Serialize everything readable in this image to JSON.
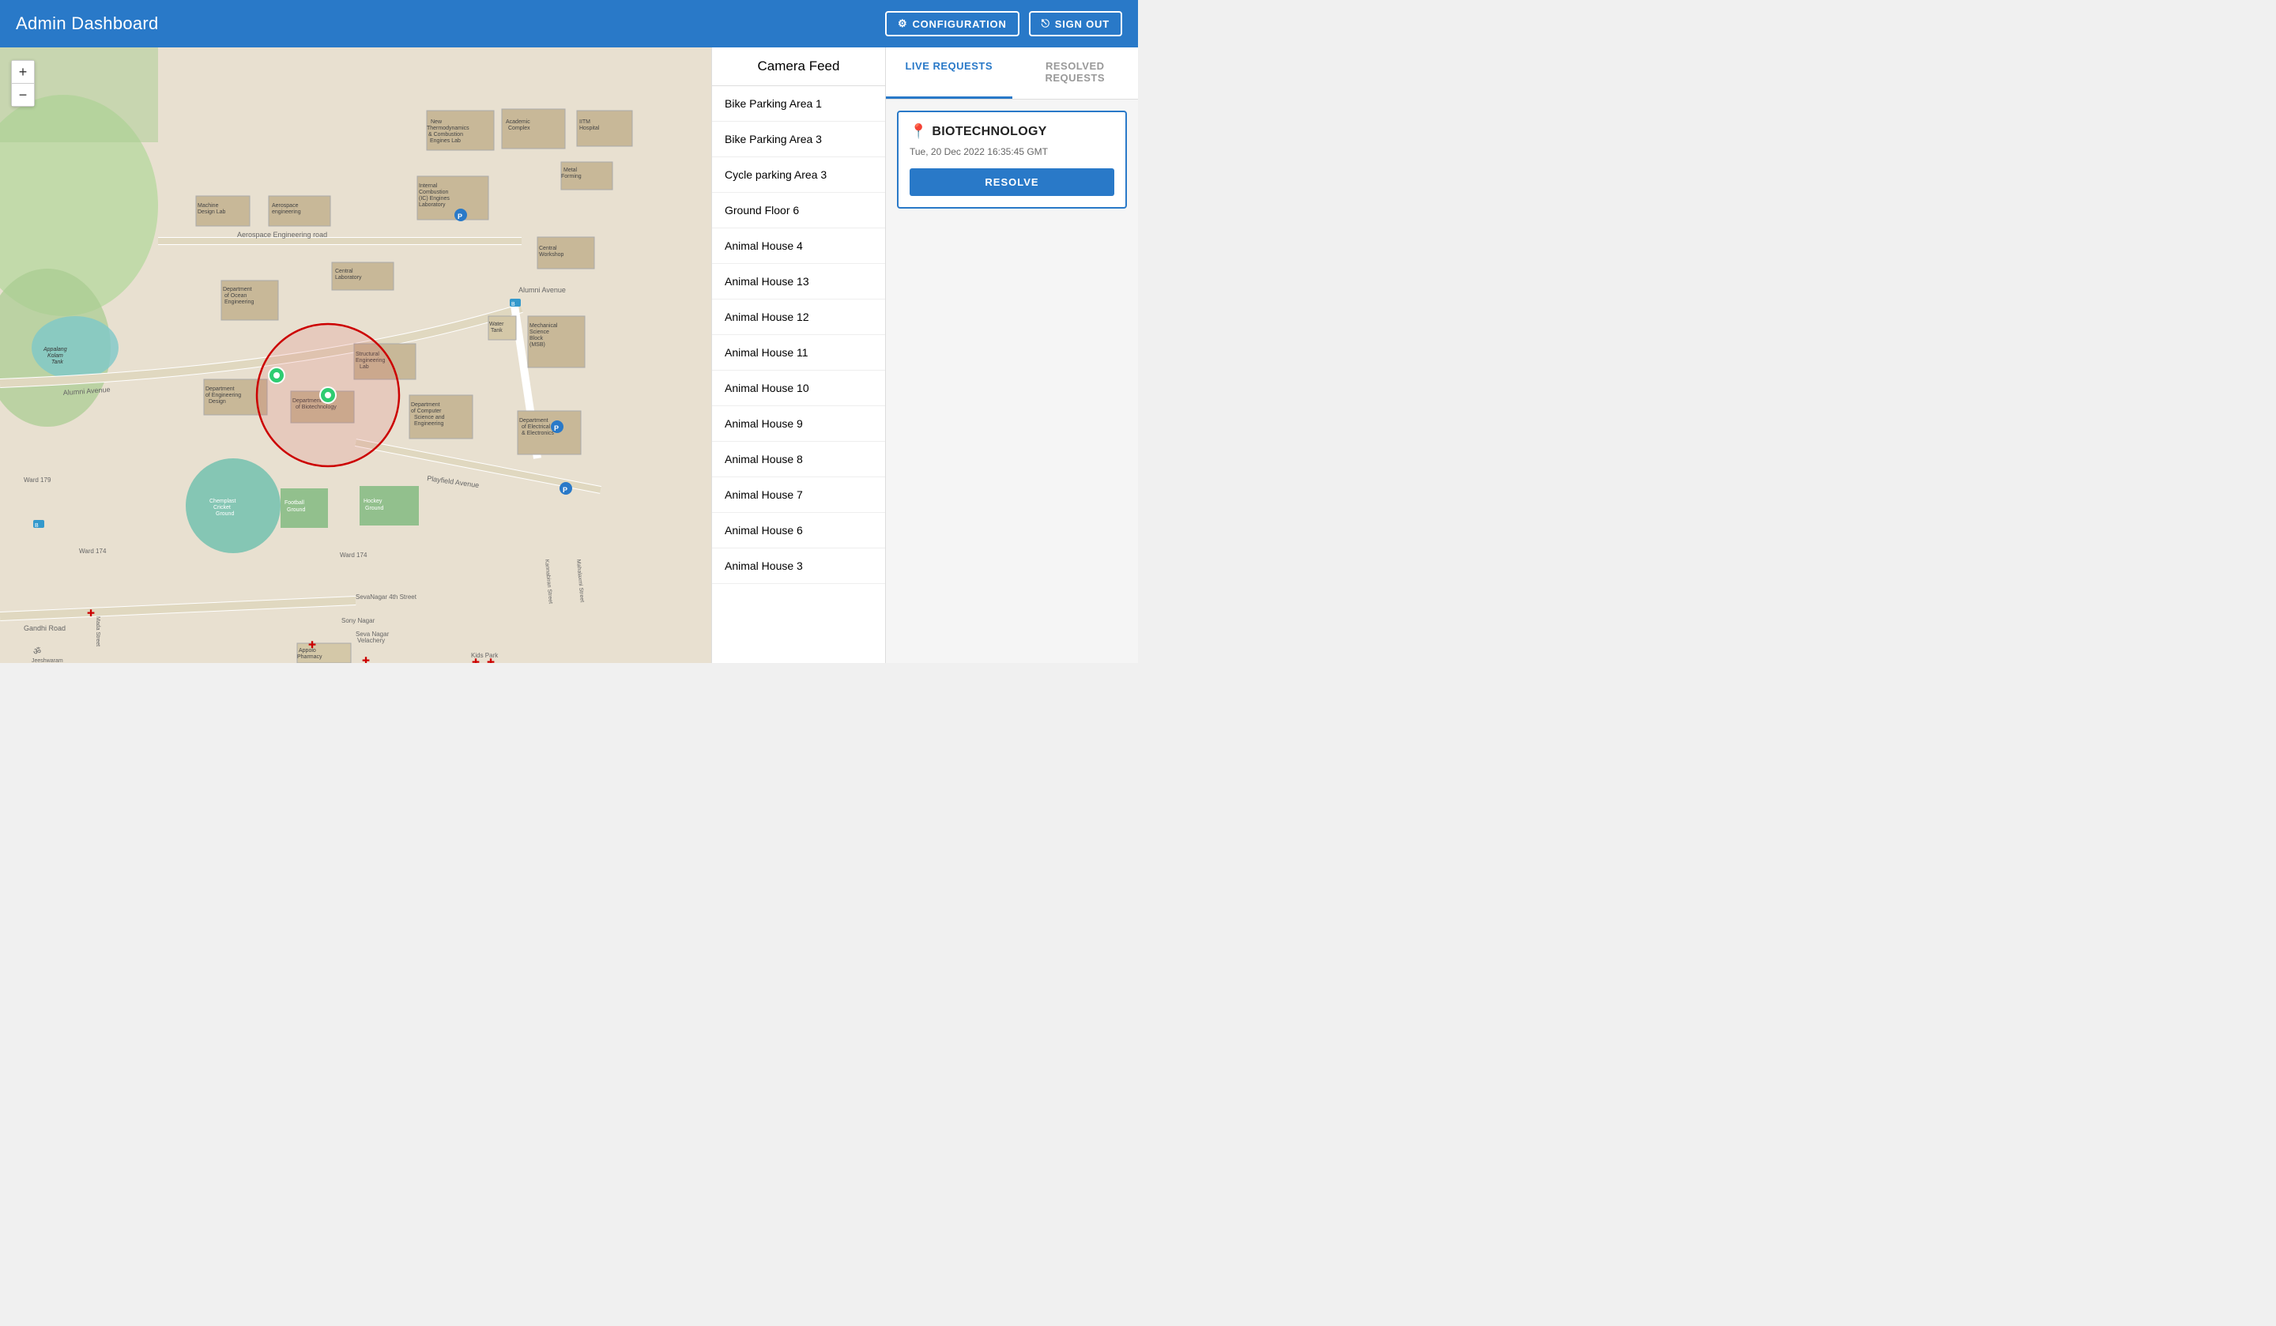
{
  "header": {
    "title": "Admin Dashboard",
    "config_label": "CONFIGURATION",
    "signout_label": "SIGN OUT"
  },
  "camera_feed": {
    "title": "Camera Feed",
    "items": [
      "Bike Parking Area 1",
      "Bike Parking Area 3",
      "Cycle parking Area 3",
      "Ground Floor 6",
      "Animal House 4",
      "Animal House 13",
      "Animal House 12",
      "Animal House 11",
      "Animal House 10",
      "Animal House 9",
      "Animal House 8",
      "Animal House 7",
      "Animal House 6",
      "Animal House 3"
    ]
  },
  "tabs": {
    "live_requests": "LIVE REQUESTS",
    "resolved_requests": "RESOLVED REQUESTS"
  },
  "live_request": {
    "location": "BIOTECHNOLOGY",
    "time": "Tue, 20 Dec 2022 16:35:45 GMT",
    "resolve_label": "RESOLVE"
  },
  "zoom": {
    "plus": "+",
    "minus": "−"
  },
  "colors": {
    "header_bg": "#2979c8",
    "accent": "#2979c8",
    "alert_red": "#e53935"
  }
}
